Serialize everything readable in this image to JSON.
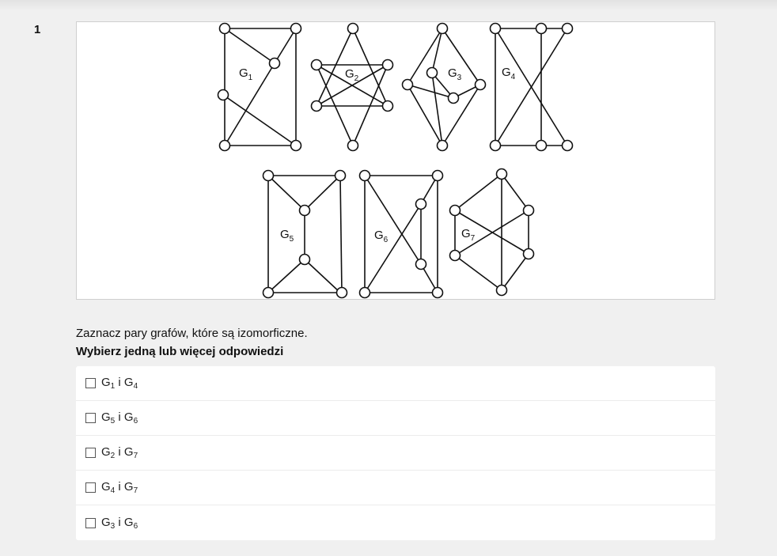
{
  "question": {
    "number": "1",
    "prompt": "Zaznacz pary grafów, które są izomorficzne.",
    "instruction": "Wybierz jedną lub więcej odpowiedzi"
  },
  "figure": {
    "graph_labels": [
      {
        "letter": "G",
        "index": "1"
      },
      {
        "letter": "G",
        "index": "2"
      },
      {
        "letter": "G",
        "index": "3"
      },
      {
        "letter": "G",
        "index": "4"
      },
      {
        "letter": "G",
        "index": "5"
      },
      {
        "letter": "G",
        "index": "6"
      },
      {
        "letter": "G",
        "index": "7"
      }
    ]
  },
  "answers": [
    {
      "a_letter": "G",
      "a_index": "1",
      "joiner": " i ",
      "b_letter": "G",
      "b_index": "4",
      "checked": false
    },
    {
      "a_letter": "G",
      "a_index": "5",
      "joiner": " i ",
      "b_letter": "G",
      "b_index": "6",
      "checked": false
    },
    {
      "a_letter": "G",
      "a_index": "2",
      "joiner": " i ",
      "b_letter": "G",
      "b_index": "7",
      "checked": false
    },
    {
      "a_letter": "G",
      "a_index": "4",
      "joiner": " i ",
      "b_letter": "G",
      "b_index": "7",
      "checked": false
    },
    {
      "a_letter": "G",
      "a_index": "3",
      "joiner": " i ",
      "b_letter": "G",
      "b_index": "6",
      "checked": false
    }
  ]
}
